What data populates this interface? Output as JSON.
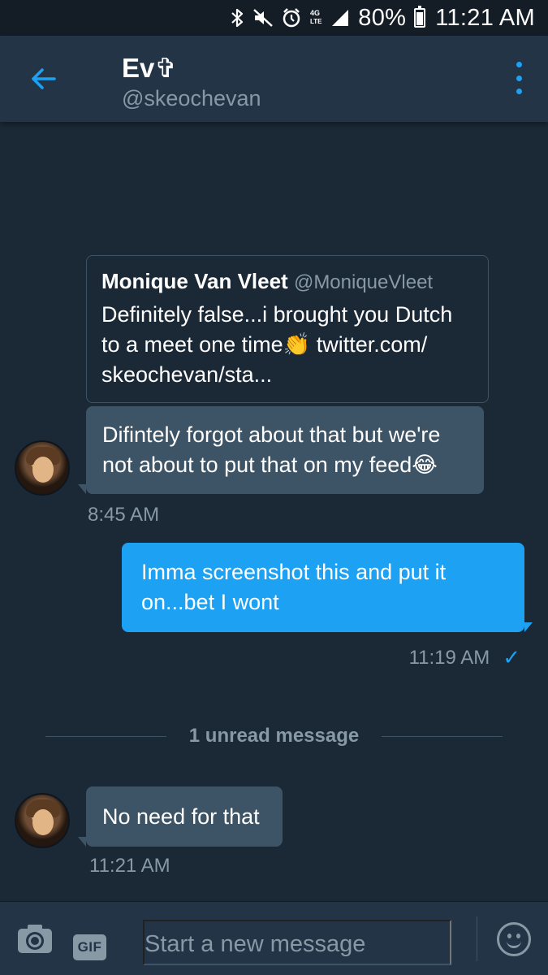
{
  "status_bar": {
    "battery_percent": "80%",
    "time": "11:21 AM",
    "icons": [
      "bluetooth-icon",
      "mute-icon",
      "alarm-icon",
      "lte-icon",
      "signal-icon",
      "battery-icon"
    ],
    "battery_level": 0.8
  },
  "header": {
    "name": "Ev✞",
    "handle": "@skeochevan",
    "back_icon": "arrow-left-icon",
    "menu_icon": "more-vertical-icon"
  },
  "messages": {
    "quoted_tweet": {
      "author_name": "Monique Van Vleet",
      "author_handle": "@MoniqueVleet",
      "text": "Definitely false...i brought you Dutch to a meet one time👏 twitter.com/ skeochevan/sta..."
    },
    "msg1": {
      "text": "Difintely forgot about that but we're not about to put that on my feed😂",
      "time": "8:45 AM"
    },
    "msg2": {
      "text": "Imma screenshot this and put it on...bet I wont",
      "time": "11:19 AM",
      "status_icon": "checkmark-icon"
    },
    "unread_divider": "1 unread message",
    "msg3": {
      "text": "No need for that",
      "time": "11:21 AM"
    }
  },
  "composer": {
    "placeholder": "Start a new message",
    "gif_label": "GIF",
    "camera_icon": "camera-icon",
    "emoji_icon": "emoji-icon"
  },
  "colors": {
    "background": "#1b2836",
    "header": "#243447",
    "incoming_bubble": "#3d5466",
    "outgoing_bubble": "#1da1f2",
    "accent": "#1da1f2",
    "muted_text": "#8899a6"
  }
}
